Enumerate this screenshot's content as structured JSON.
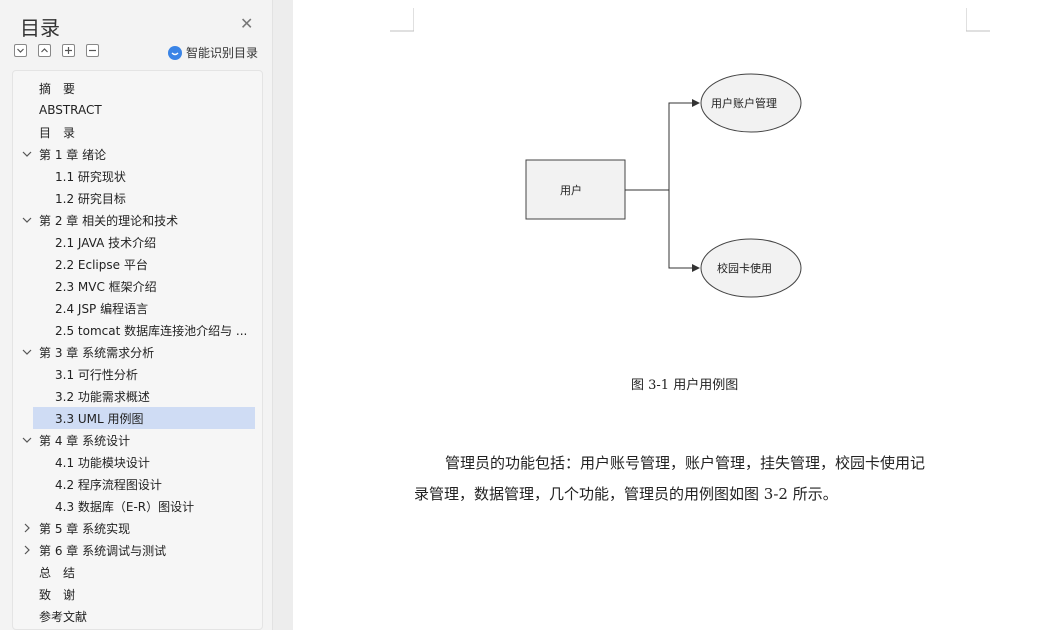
{
  "sidebar": {
    "title": "目录",
    "ai_label": "智能识别目录",
    "toc": [
      {
        "label": "摘　要",
        "level": 1
      },
      {
        "label": "ABSTRACT",
        "level": 1
      },
      {
        "label": "目　录",
        "level": 1
      },
      {
        "label": "第 1 章  绪论",
        "level": 1,
        "expandable": true,
        "expanded": true
      },
      {
        "label": "1.1 研究现状",
        "level": 2
      },
      {
        "label": "1.2 研究目标",
        "level": 2
      },
      {
        "label": "第 2 章  相关的理论和技术",
        "level": 1,
        "expandable": true,
        "expanded": true
      },
      {
        "label": "2.1 JAVA 技术介绍",
        "level": 2
      },
      {
        "label": "2.2 Eclipse 平台",
        "level": 2
      },
      {
        "label": "2.3 MVC 框架介绍",
        "level": 2
      },
      {
        "label": "2.4 JSP  编程语言",
        "level": 2
      },
      {
        "label": "2.5 tomcat  数据库连接池介绍与 ...",
        "level": 2
      },
      {
        "label": "第 3 章  系统需求分析",
        "level": 1,
        "expandable": true,
        "expanded": true
      },
      {
        "label": "3.1  可行性分析",
        "level": 2
      },
      {
        "label": "3.2  功能需求概述",
        "level": 2
      },
      {
        "label": "3.3 UML 用例图",
        "level": 2,
        "selected": true
      },
      {
        "label": "第 4 章  系统设计",
        "level": 1,
        "expandable": true,
        "expanded": true
      },
      {
        "label": "4.1 功能模块设计",
        "level": 2
      },
      {
        "label": "4.2  程序流程图设计",
        "level": 2
      },
      {
        "label": "4.3  数据库（E-R）图设计",
        "level": 2
      },
      {
        "label": "第 5 章  系统实现",
        "level": 1,
        "expandable": true,
        "expanded": false
      },
      {
        "label": "第 6 章  系统调试与测试",
        "level": 1,
        "expandable": true,
        "expanded": false
      },
      {
        "label": "总　结",
        "level": 1
      },
      {
        "label": "致　谢",
        "level": 1
      },
      {
        "label": "参考文献",
        "level": 1
      }
    ]
  },
  "document": {
    "diagram": {
      "actor": "用户",
      "use_cases": [
        "用户账户管理",
        "校园卡使用"
      ]
    },
    "caption": "图 3-1  用户用例图",
    "paragraph": {
      "line1": "管理员的功能包括：用户账号管理，账户管理，挂失管理，校园卡使用记",
      "line2": "录管理，数据管理，几个功能，管理员的用例图如图 3-2 所示。"
    }
  },
  "colors": {
    "selected_bg": "#cfdcf4",
    "accent": "#3a84e6",
    "ellipse_fill": "#f2f2f2"
  }
}
